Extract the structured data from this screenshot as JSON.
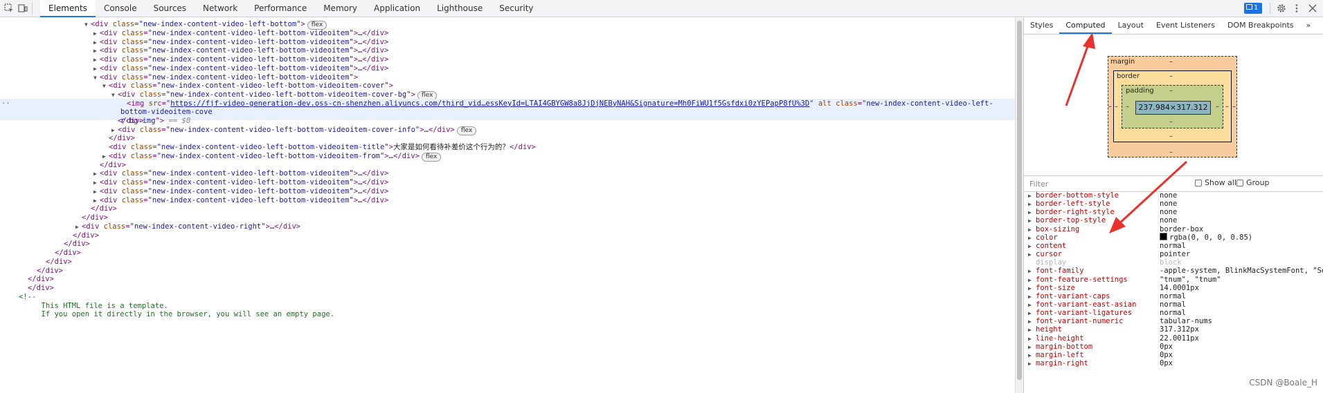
{
  "toolbar": {
    "tabs": [
      "Elements",
      "Console",
      "Sources",
      "Network",
      "Performance",
      "Memory",
      "Application",
      "Lighthouse",
      "Security"
    ],
    "issues_count": "1"
  },
  "dom": {
    "lines": [
      {
        "indent": 7,
        "tri": "open",
        "html": "<div class=\"new-index-content-video-left-bottom\">",
        "badge": "flex"
      },
      {
        "indent": 8,
        "tri": "closed",
        "html": "<div class=\"new-index-content-video-left-bottom-videoitem\">…</div>"
      },
      {
        "indent": 8,
        "tri": "closed",
        "html": "<div class=\"new-index-content-video-left-bottom-videoitem\">…</div>"
      },
      {
        "indent": 8,
        "tri": "closed",
        "html": "<div class=\"new-index-content-video-left-bottom-videoitem\">…</div>"
      },
      {
        "indent": 8,
        "tri": "closed",
        "html": "<div class=\"new-index-content-video-left-bottom-videoitem\">…</div>"
      },
      {
        "indent": 8,
        "tri": "closed",
        "html": "<div class=\"new-index-content-video-left-bottom-videoitem\">…</div>"
      },
      {
        "indent": 8,
        "tri": "open",
        "html": "<div class=\"new-index-content-video-left-bottom-videoitem\">"
      },
      {
        "indent": 9,
        "tri": "open",
        "html": "<div class=\"new-index-content-video-left-bottom-videoitem-cover\">"
      },
      {
        "indent": 10,
        "tri": "open",
        "html": "<div class=\"new-index-content-video-left-bottom-videoitem-cover-bg\">",
        "badge": "flex"
      },
      {
        "indent": 11,
        "tri": "none",
        "selected": true,
        "img": true
      },
      {
        "indent": 10,
        "tri": "none",
        "html": "</div>"
      },
      {
        "indent": 10,
        "tri": "closed",
        "html": "<div class=\"new-index-content-video-left-bottom-videoitem-cover-info\">…</div>",
        "badge": "flex"
      },
      {
        "indent": 9,
        "tri": "none",
        "html": "</div>"
      },
      {
        "indent": 9,
        "tri": "none",
        "title": true
      },
      {
        "indent": 9,
        "tri": "closed",
        "html": "<div class=\"new-index-content-video-left-bottom-videoitem-from\">…</div>",
        "badge": "flex"
      },
      {
        "indent": 8,
        "tri": "none",
        "html": "</div>"
      },
      {
        "indent": 8,
        "tri": "closed",
        "html": "<div class=\"new-index-content-video-left-bottom-videoitem\">…</div>"
      },
      {
        "indent": 8,
        "tri": "closed",
        "html": "<div class=\"new-index-content-video-left-bottom-videoitem\">…</div>"
      },
      {
        "indent": 8,
        "tri": "closed",
        "html": "<div class=\"new-index-content-video-left-bottom-videoitem\">…</div>"
      },
      {
        "indent": 8,
        "tri": "closed",
        "html": "<div class=\"new-index-content-video-left-bottom-videoitem\">…</div>"
      },
      {
        "indent": 7,
        "tri": "none",
        "html": "</div>"
      },
      {
        "indent": 6,
        "tri": "none",
        "html": "</div>"
      },
      {
        "indent": 6,
        "tri": "closed",
        "html": "<div class=\"new-index-content-video-right\">…</div>"
      },
      {
        "indent": 5,
        "tri": "none",
        "html": "</div>"
      },
      {
        "indent": 4,
        "tri": "none",
        "html": "</div>"
      },
      {
        "indent": 3,
        "tri": "none",
        "html": "</div>"
      },
      {
        "indent": 2,
        "tri": "none",
        "html": "</div>"
      },
      {
        "indent": 1,
        "tri": "none",
        "html": "</div>"
      },
      {
        "indent": 0,
        "tri": "none",
        "html": "</div>"
      },
      {
        "indent": 0,
        "tri": "none",
        "html": "</div>"
      },
      {
        "indent": -1,
        "tri": "none",
        "comment": "<!--"
      },
      {
        "indent": 1.5,
        "tri": "none",
        "comment": "This HTML file is a template."
      },
      {
        "indent": 1.5,
        "tri": "none",
        "comment": "If you open it directly in the browser, you will see an empty page."
      }
    ],
    "img_src": "https://fjf-video-generation-dev.oss-cn-shenzhen.aliyuncs.com/third_vid…essKeyId=LTAI4GBYGW8a8JjDjNEByNAH&Signature=Mh0FiWU1f5Gsfdxi0zYEPapP8fU%3D",
    "img_class_a": "new-index-content-video-left-bottom-videoitem-cove",
    "img_class_b": "r-bg-img",
    "img_eq": "== $0",
    "title_text": "大家是如何看待补差价这个行为的？"
  },
  "right_tabs": [
    "Styles",
    "Computed",
    "Layout",
    "Event Listeners",
    "DOM Breakpoints",
    "»"
  ],
  "boxmodel": {
    "margin_label": "margin",
    "border_label": "border",
    "padding_label": "padding",
    "content_size": "237.984×317.312",
    "dash": "–"
  },
  "filter": {
    "placeholder": "Filter",
    "show_all": "Show all",
    "group": "Group"
  },
  "computed": [
    {
      "name": "border-bottom-style",
      "value": "none"
    },
    {
      "name": "border-left-style",
      "value": "none"
    },
    {
      "name": "border-right-style",
      "value": "none"
    },
    {
      "name": "border-top-style",
      "value": "none"
    },
    {
      "name": "box-sizing",
      "value": "border-box"
    },
    {
      "name": "color",
      "value": "rgba(0, 0, 0, 0.85)",
      "swatch": true
    },
    {
      "name": "content",
      "value": "normal"
    },
    {
      "name": "cursor",
      "value": "pointer"
    },
    {
      "name": "display",
      "value": "block",
      "dim": true
    },
    {
      "name": "font-family",
      "value": "-apple-system, BlinkMacSystemFont, \"Se"
    },
    {
      "name": "font-feature-settings",
      "value": "\"tnum\", \"tnum\""
    },
    {
      "name": "font-size",
      "value": "14.0001px"
    },
    {
      "name": "font-variant-caps",
      "value": "normal"
    },
    {
      "name": "font-variant-east-asian",
      "value": "normal"
    },
    {
      "name": "font-variant-ligatures",
      "value": "normal"
    },
    {
      "name": "font-variant-numeric",
      "value": "tabular-nums"
    },
    {
      "name": "height",
      "value": "317.312px"
    },
    {
      "name": "line-height",
      "value": "22.0011px"
    },
    {
      "name": "margin-bottom",
      "value": "0px"
    },
    {
      "name": "margin-left",
      "value": "0px"
    },
    {
      "name": "margin-right",
      "value": "0px"
    }
  ],
  "watermark": "CSDN @Boale_H",
  "colors": {
    "accent": "#1a73e8",
    "arrow": "#e8322b"
  }
}
